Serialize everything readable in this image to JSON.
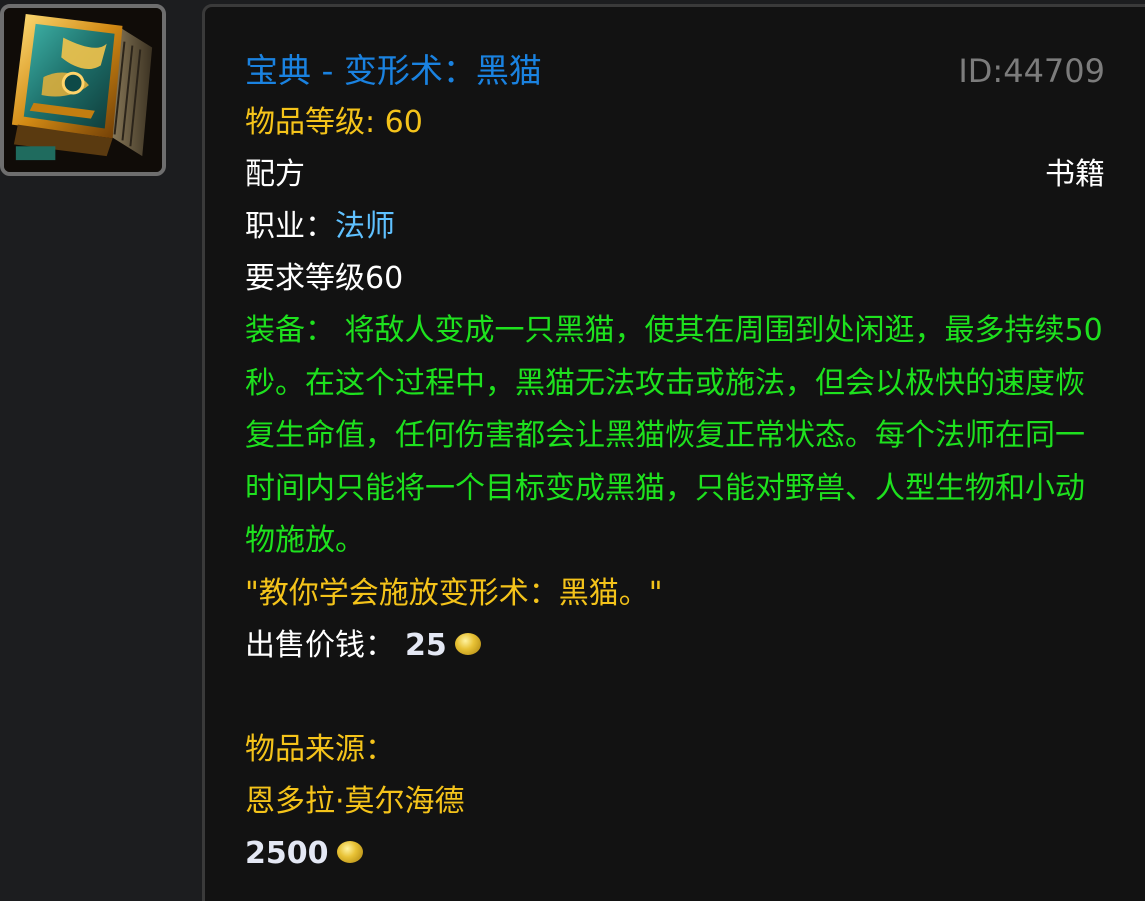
{
  "icon": {
    "name": "book-icon",
    "accent": "#2fa09a",
    "frame": "#6e6e6e"
  },
  "item": {
    "title": "宝典 - 变形术：黑猫",
    "id_text": "ID:44709",
    "level_label": "物品等级: ",
    "level_value": "60",
    "type_left": "配方",
    "type_right": "书籍",
    "class_label": "职业：",
    "class_value": "法师",
    "req_level": "要求等级60",
    "equip_text": "装备： 将敌人变成一只黑猫，使其在周围到处闲逛，最多持续50秒。在这个过程中，黑猫无法攻击或施法，但会以极快的速度恢复生命值，任何伤害都会让黑猫恢复正常状态。每个法师在同一时间内只能将一个目标变成黑猫，只能对野兽、人型生物和小动物施放。",
    "quote": "\"教你学会施放变形术：黑猫。\"",
    "sell_label": "出售价钱：",
    "sell_value": "25",
    "source_label": "物品来源：",
    "source_name": "恩多拉·莫尔海德",
    "source_price": "2500"
  },
  "colors": {
    "title": "#1a82e0",
    "id": "#7c7c7c",
    "gold_text": "#f4c31a",
    "green_text": "#1ee11e",
    "class_value": "#5fc1ff",
    "background": "#121212"
  }
}
